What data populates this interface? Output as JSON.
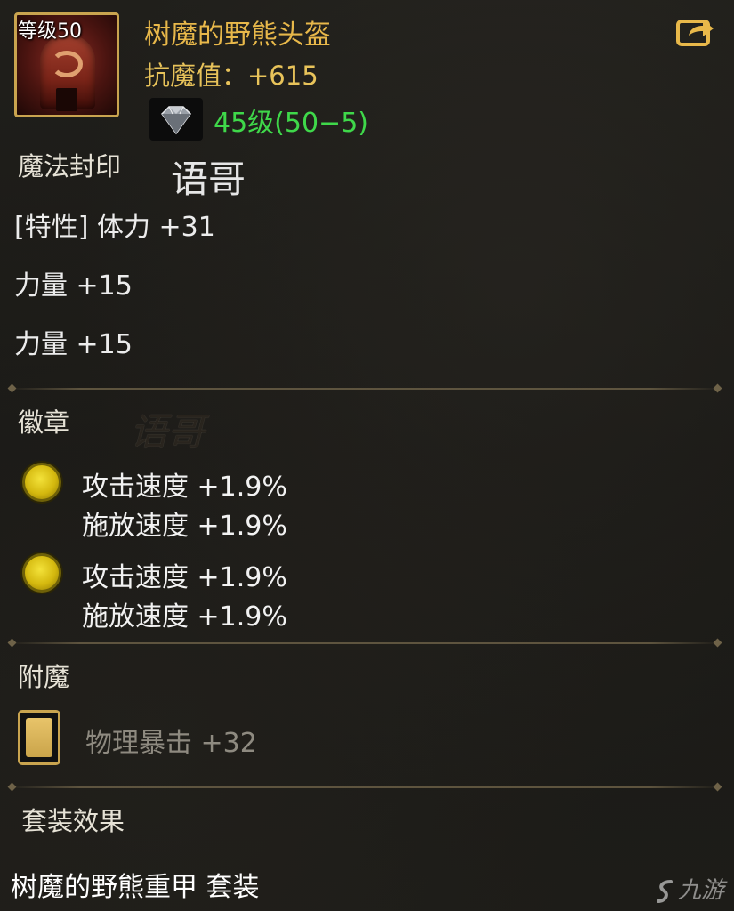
{
  "item": {
    "level_badge": "等级50",
    "name": "树魔的野熊头盔",
    "resist": "抗魔值：+615",
    "gem_level": "45级(50−5)"
  },
  "watermark": {
    "text1": "语哥",
    "text2": "语哥"
  },
  "magic_seal": {
    "title": "魔法封印",
    "trait": "[特性] 体力 +31",
    "attr1": "力量 +15",
    "attr2": "力量 +15"
  },
  "badges": {
    "title": "徽章",
    "items": [
      {
        "line1": "攻击速度 +1.9%",
        "line2": "施放速度 +1.9%"
      },
      {
        "line1": "攻击速度 +1.9%",
        "line2": "施放速度 +1.9%"
      }
    ]
  },
  "enchant": {
    "title": "附魔",
    "effect": "物理暴击 +32"
  },
  "set": {
    "title": "套装效果",
    "name": "树魔的野熊重甲  套装"
  },
  "logo": {
    "text": "九游"
  },
  "colors": {
    "gold_border": "#c9a44f",
    "item_name": "#e8b84a",
    "resist": "#e8c35a",
    "gem_level": "#3fd84a",
    "badge_orb": "#e8d42a",
    "enchant_text": "#8e8a80"
  },
  "icons": {
    "item": "helmet-icon",
    "share": "share-icon",
    "gem": "diamond-gem-icon",
    "badge": "gold-orb-icon",
    "enchant": "enchant-card-icon"
  }
}
